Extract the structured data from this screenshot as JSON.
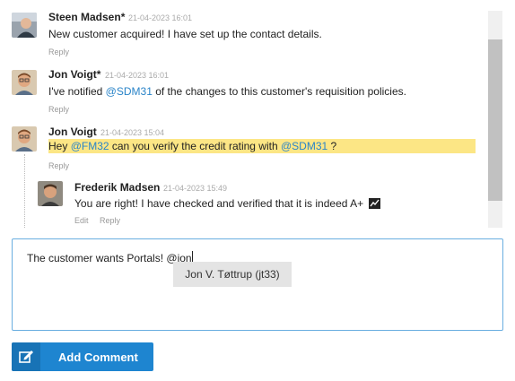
{
  "comments": [
    {
      "author": "Steen Madsen*",
      "time": "21-04-2023 16:01",
      "text": "New customer acquired! I have set up the contact details.",
      "reply": "Reply"
    },
    {
      "author": "Jon Voigt*",
      "time": "21-04-2023 16:01",
      "text_pre": "I've notified ",
      "mention": "@SDM31",
      "text_post": " of the changes to this customer's requisition policies.",
      "reply": "Reply"
    },
    {
      "author": "Jon Voigt",
      "time": "21-04-2023 15:04",
      "text_pre": "Hey ",
      "mention1": "@FM32",
      "text_mid": " can you verify the credit rating with ",
      "mention2": "@SDM31",
      "text_post": " ?",
      "reply": "Reply"
    },
    {
      "author": "Frederik Madsen",
      "time": "21-04-2023 15:49",
      "text": "You are right! I have checked and verified that it is indeed A+",
      "edit": "Edit",
      "reply": "Reply"
    }
  ],
  "composer": {
    "value": "The customer wants Portals! @jon"
  },
  "suggestion": {
    "text": "Jon V. Tøttrup (jt33)"
  },
  "add_button": {
    "label": "Add Comment"
  }
}
